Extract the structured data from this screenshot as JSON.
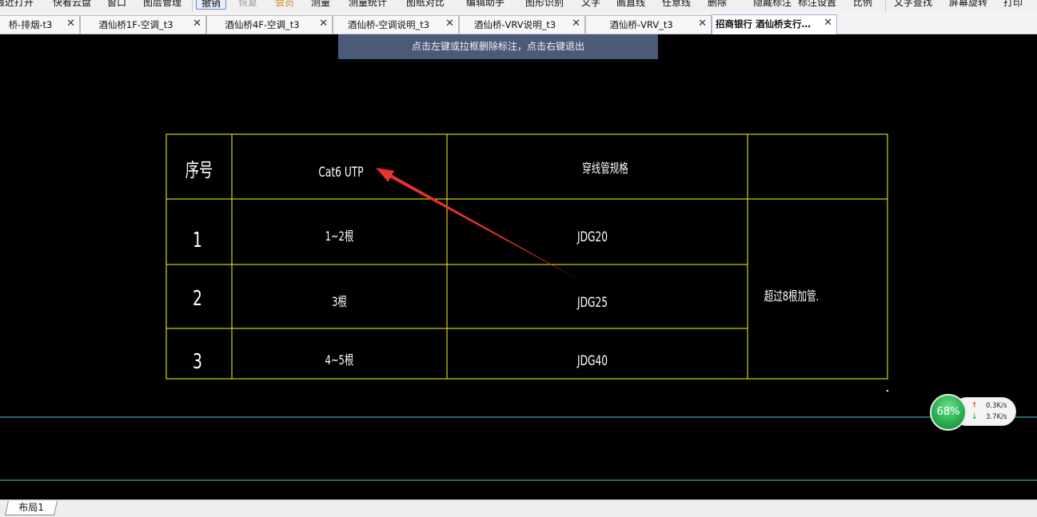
{
  "toolbar": {
    "items": [
      {
        "label": "最近打开",
        "state": "normal"
      },
      {
        "label": "快看云盘",
        "state": "normal"
      },
      {
        "label": "窗口",
        "state": "normal"
      },
      {
        "label": "图层管理",
        "state": "normal"
      },
      {
        "label": "撤销",
        "state": "active"
      },
      {
        "label": "恢复",
        "state": "disabled"
      },
      {
        "label": "会员",
        "state": "vip"
      },
      {
        "label": "测量",
        "state": "normal"
      },
      {
        "label": "测量统计",
        "state": "normal"
      },
      {
        "label": "图纸对比",
        "state": "normal"
      },
      {
        "label": "编辑助手",
        "state": "normal"
      },
      {
        "label": "图形识别",
        "state": "normal"
      },
      {
        "label": "文字",
        "state": "normal"
      },
      {
        "label": "画直线",
        "state": "normal"
      },
      {
        "label": "任意线",
        "state": "normal"
      },
      {
        "label": "删除",
        "state": "normal"
      },
      {
        "label": "隐藏标注",
        "state": "normal"
      },
      {
        "label": "标注设置",
        "state": "normal"
      },
      {
        "label": "比例",
        "state": "normal"
      },
      {
        "label": "文字查找",
        "state": "normal"
      },
      {
        "label": "屏幕旋转",
        "state": "normal"
      },
      {
        "label": "打印",
        "state": "normal"
      }
    ]
  },
  "tabs": [
    {
      "label": "桥-排烟-t3",
      "active": false
    },
    {
      "label": "酒仙桥1F-空调_t3",
      "active": false
    },
    {
      "label": "酒仙桥4F-空调_t3",
      "active": false
    },
    {
      "label": "酒仙桥-空调说明_t3",
      "active": false
    },
    {
      "label": "酒仙桥-VRV说明_t3",
      "active": false
    },
    {
      "label": "酒仙桥-VRV_t3",
      "active": false
    },
    {
      "label": "招商银行 酒仙桥支行…",
      "active": true
    }
  ],
  "tab_close_glyph": "✕",
  "hint": "点击左键或拉框删除标注，点击右键退出",
  "cad_table": {
    "headers": [
      "序号",
      "Cat6 UTP",
      "穿线管规格",
      ""
    ],
    "rows": [
      {
        "index": "1",
        "count": "1~2根",
        "spec": "JDG20"
      },
      {
        "index": "2",
        "count": "3根",
        "spec": "JDG25"
      },
      {
        "index": "3",
        "count": "4~5根",
        "spec": "JDG40"
      }
    ],
    "note": "超过8根加管.",
    "line_color": "#ffff00",
    "text_color": "#ffffff"
  },
  "annotation": {
    "color": "#e8342a"
  },
  "guide_line_color": "#3fd0d8",
  "net_widget": {
    "percent": "68%",
    "up_rate": "0.3K/s",
    "down_rate": "3.7K/s",
    "up_arrow": "↑",
    "down_arrow": "↓"
  },
  "layout_tab": "布局1"
}
